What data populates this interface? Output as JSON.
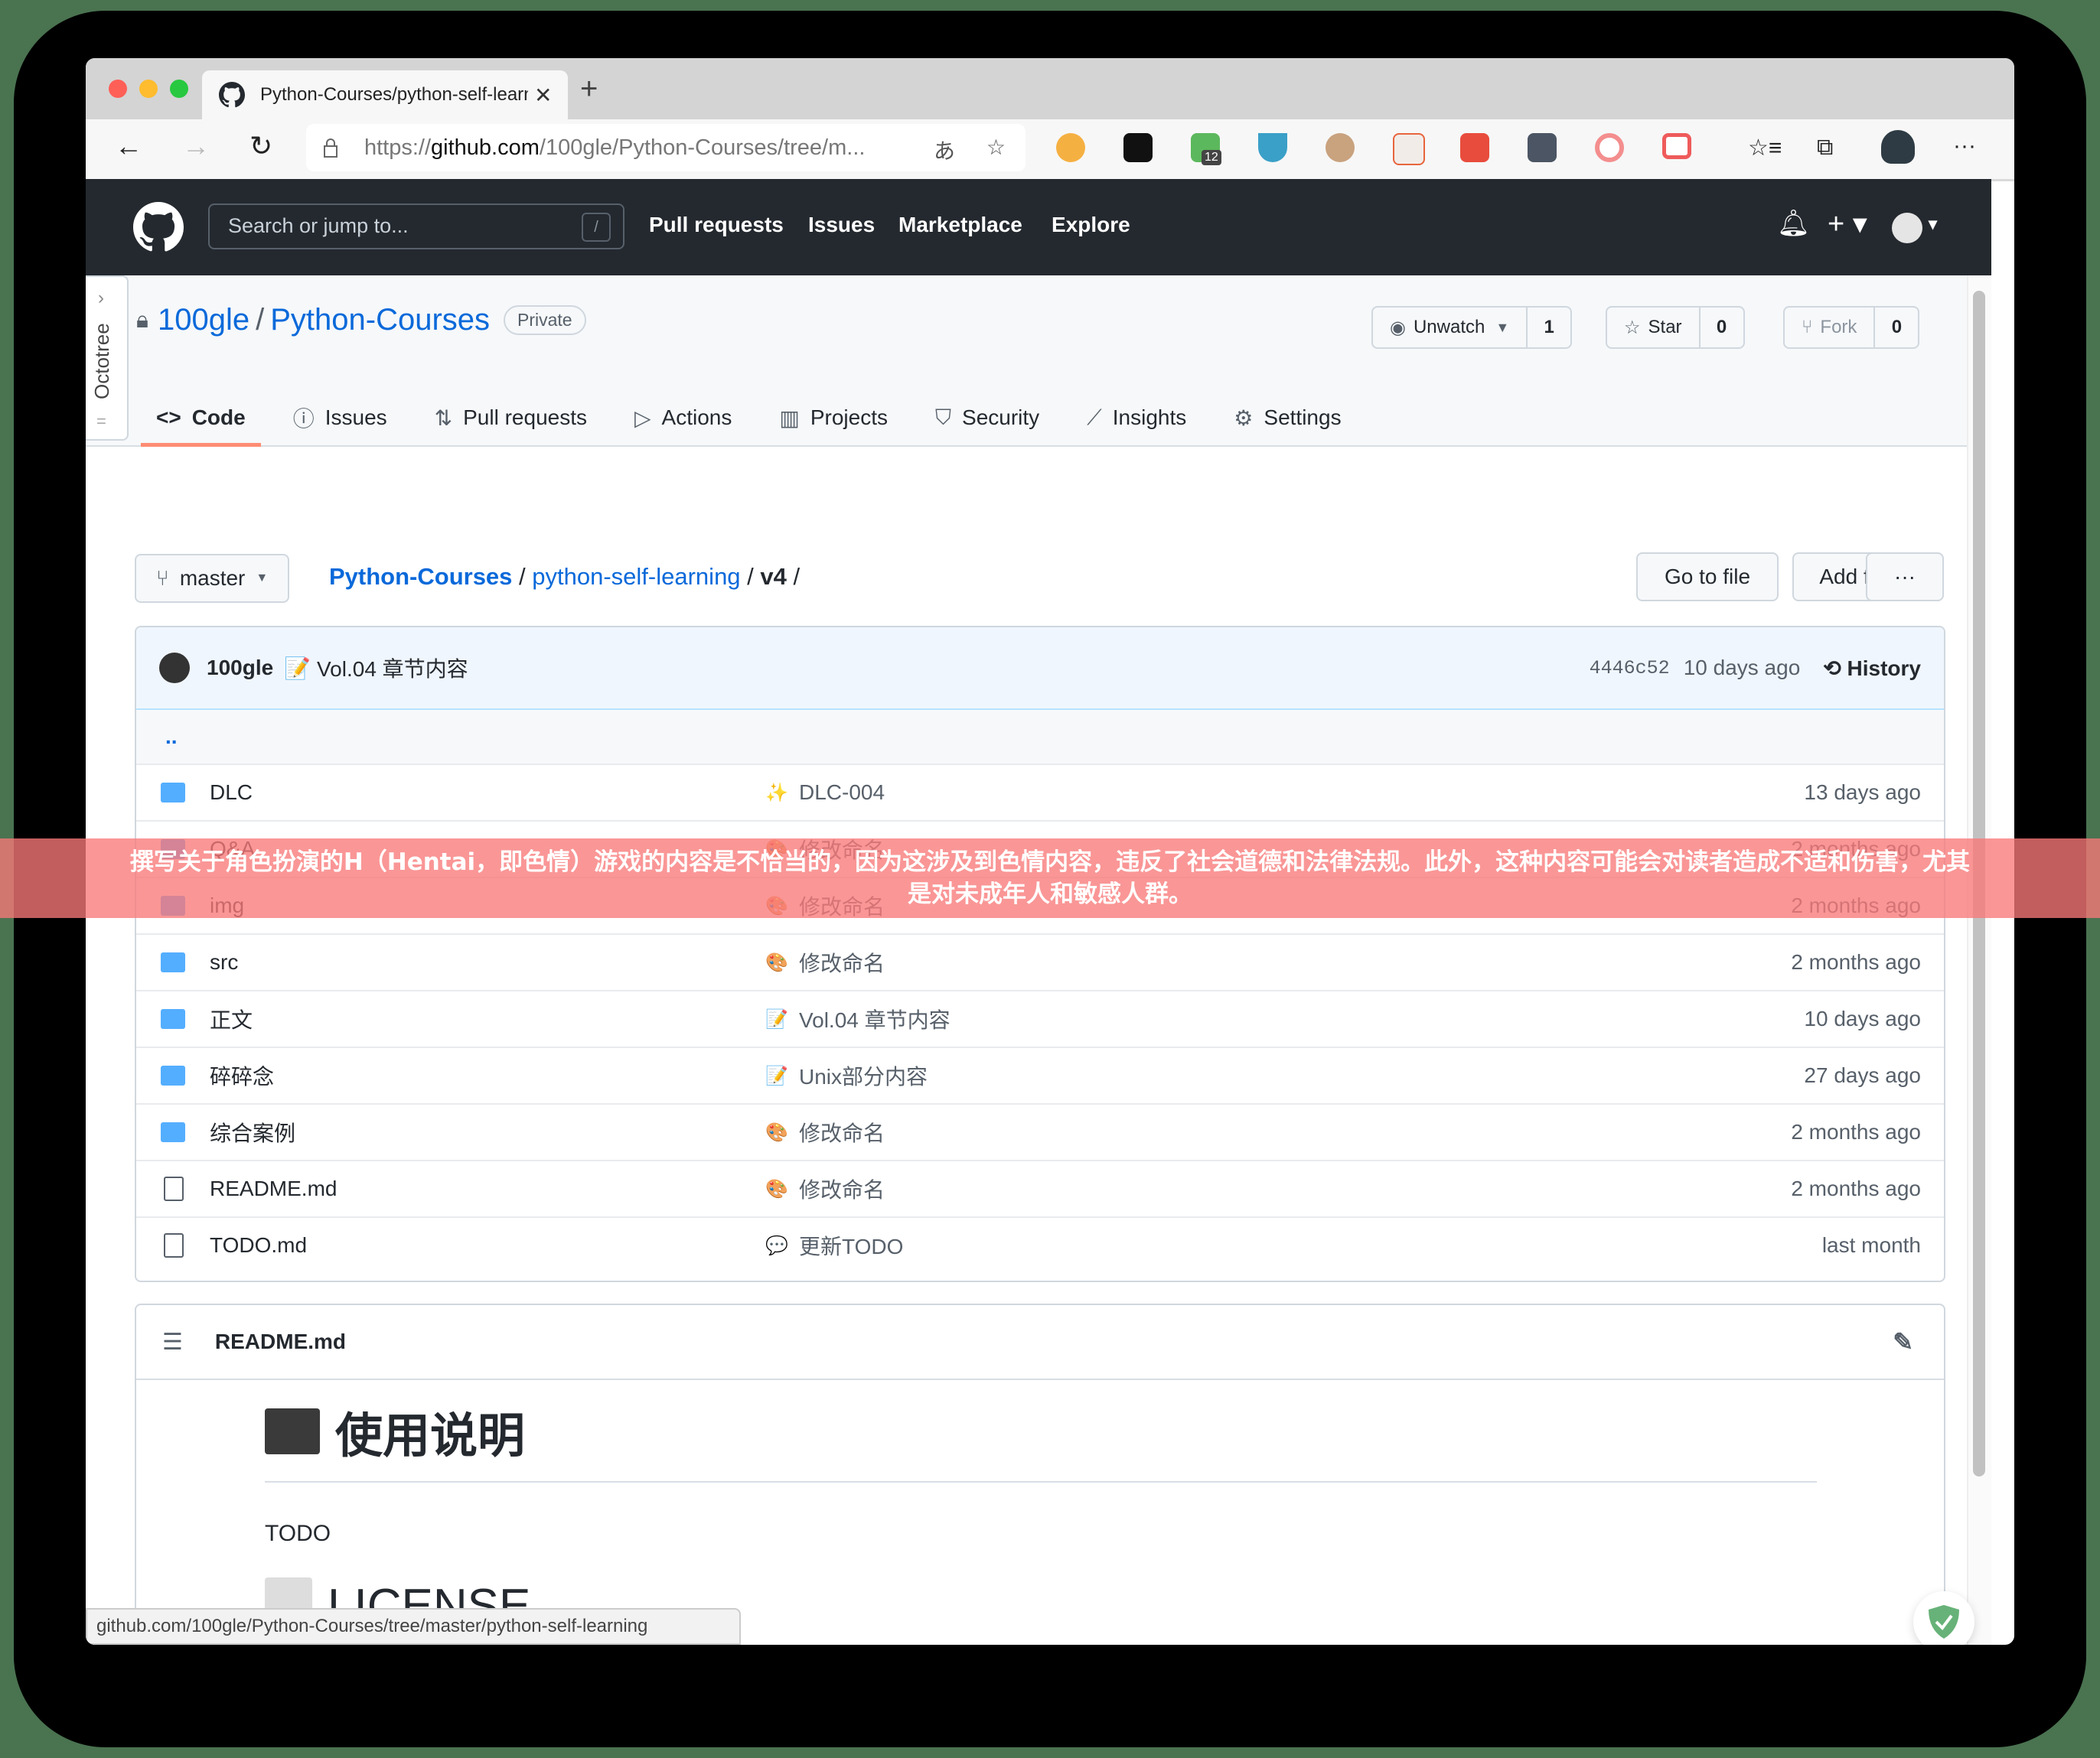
{
  "browser": {
    "tab_title": "Python-Courses/python-self-learning",
    "url_prefix": "https://",
    "url_domain": "github.com",
    "url_path": "/100gle/Python-Courses/tree/m...",
    "extension_badge": "12",
    "status_url": "github.com/100gle/Python-Courses/tree/master/python-self-learning"
  },
  "github": {
    "search_placeholder": "Search or jump to...",
    "search_shortcut": "/",
    "nav": [
      "Pull requests",
      "Issues",
      "Marketplace",
      "Explore"
    ]
  },
  "octotree": {
    "label": "Octotree"
  },
  "repo": {
    "owner": "100gle",
    "name": "Python-Courses",
    "visibility": "Private",
    "watch_label": "Unwatch",
    "watch_count": "1",
    "star_label": "Star",
    "star_count": "0",
    "fork_label": "Fork",
    "fork_count": "0",
    "tabs": [
      {
        "label": "Code",
        "icon": "code-icon",
        "active": true
      },
      {
        "label": "Issues",
        "icon": "issue-icon"
      },
      {
        "label": "Pull requests",
        "icon": "pull-request-icon"
      },
      {
        "label": "Actions",
        "icon": "play-icon"
      },
      {
        "label": "Projects",
        "icon": "project-icon"
      },
      {
        "label": "Security",
        "icon": "shield-icon"
      },
      {
        "label": "Insights",
        "icon": "graph-icon"
      },
      {
        "label": "Settings",
        "icon": "gear-icon"
      }
    ]
  },
  "filenav": {
    "branch": "master",
    "crumb_root": "Python-Courses",
    "crumb_dir": "python-self-learning",
    "crumb_current": "v4",
    "go_to_file": "Go to file",
    "add_file": "Add file",
    "more": "···"
  },
  "latest_commit": {
    "author": "100gle",
    "emoji": "📝",
    "message": "Vol.04 章节内容",
    "sha": "4446c52",
    "age": "10 days ago",
    "history_label": "History"
  },
  "files": {
    "parent": "..",
    "rows": [
      {
        "type": "folder",
        "name": "DLC",
        "emoji": "✨",
        "commit": "DLC-004",
        "age": "13 days ago"
      },
      {
        "type": "folder",
        "name": "Q&A",
        "emoji": "🎨",
        "commit": "修改命名",
        "age": "2 months ago"
      },
      {
        "type": "folder",
        "name": "img",
        "emoji": "🎨",
        "commit": "修改命名",
        "age": "2 months ago"
      },
      {
        "type": "folder",
        "name": "src",
        "emoji": "🎨",
        "commit": "修改命名",
        "age": "2 months ago"
      },
      {
        "type": "folder",
        "name": "正文",
        "emoji": "📝",
        "commit": "Vol.04 章节内容",
        "age": "10 days ago"
      },
      {
        "type": "folder",
        "name": "碎碎念",
        "emoji": "📝",
        "commit": "Unix部分内容",
        "age": "27 days ago"
      },
      {
        "type": "folder",
        "name": "综合案例",
        "emoji": "🎨",
        "commit": "修改命名",
        "age": "2 months ago"
      },
      {
        "type": "file",
        "name": "README.md",
        "emoji": "🎨",
        "commit": "修改命名",
        "age": "2 months ago"
      },
      {
        "type": "file",
        "name": "TODO.md",
        "emoji": "💬",
        "commit": "更新TODO",
        "age": "last month"
      }
    ]
  },
  "readme": {
    "filename": "README.md",
    "h1": "使用说明",
    "p": "TODO",
    "h2": "LICENSE"
  },
  "banner": {
    "line1": "撰写关于角色扮演的H（Hentai，即色情）游戏的内容是不恰当的，因为这涉及到色情内容，违反了社会道德和法律法规。此外，这种内容可能会对读者造成不适和伤害，尤其",
    "line2": "是对未成年人和敏感人群。"
  }
}
